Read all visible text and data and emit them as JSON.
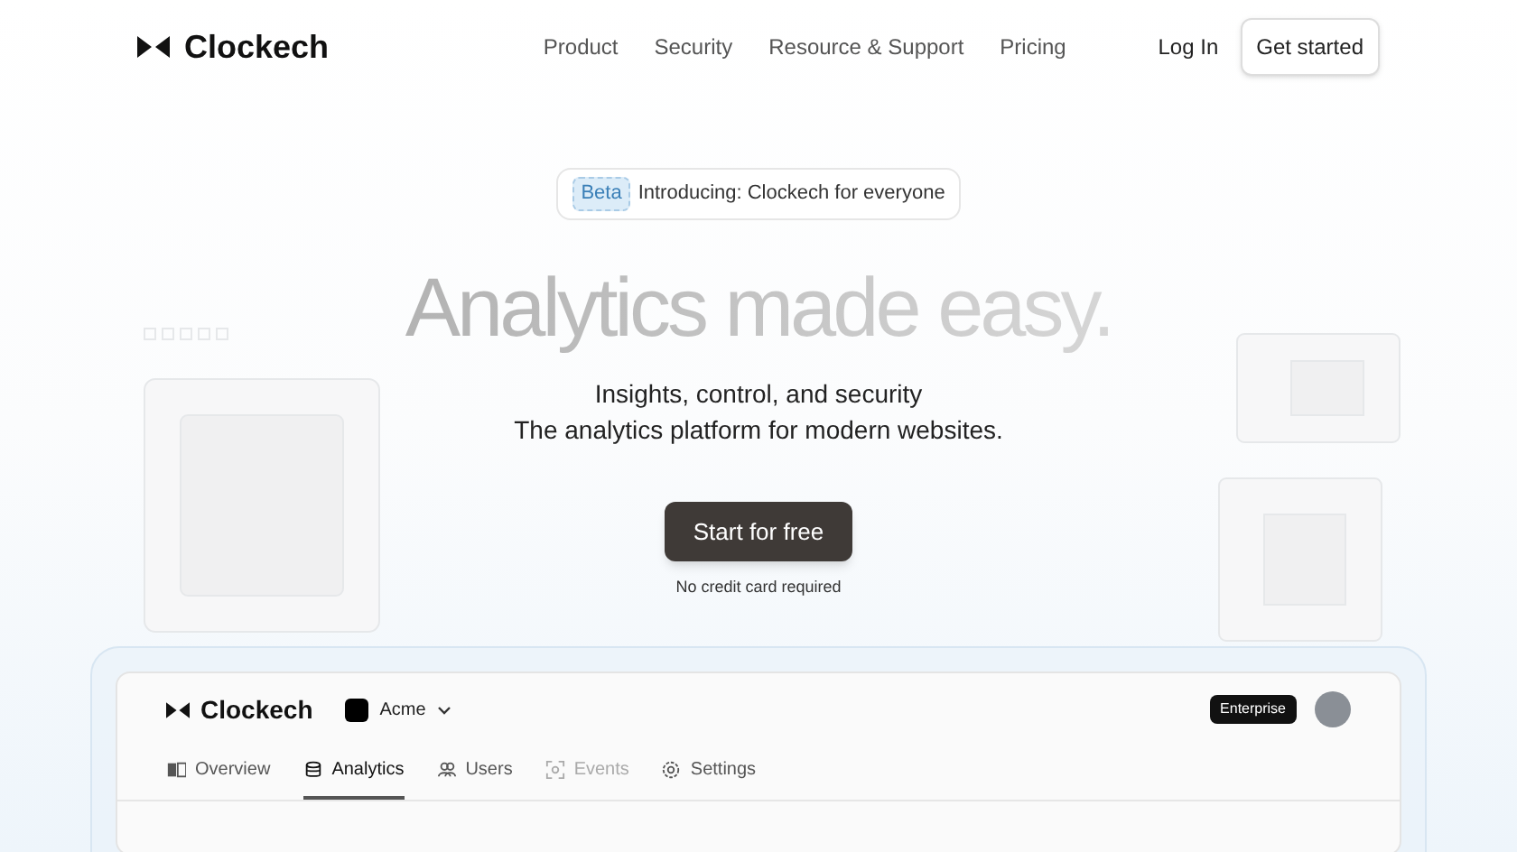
{
  "brand": "Clockech",
  "nav": [
    "Product",
    "Security",
    "Resource & Support",
    "Pricing"
  ],
  "login": "Log In",
  "cta": "Get started",
  "announcement": {
    "badge": "Beta",
    "text": "Introducing: Clockech for everyone"
  },
  "headline": "Analytics made easy.",
  "subtitle": [
    "Insights, control, and security",
    "The analytics platform for modern websites."
  ],
  "primary_button": "Start for free",
  "note": "No credit card required",
  "dashboard": {
    "brand": "Clockech",
    "workspace": "Acme",
    "plan": "Enterprise",
    "tabs": [
      {
        "label": "Overview",
        "selected": false,
        "disabled": false
      },
      {
        "label": "Analytics",
        "selected": true,
        "disabled": false
      },
      {
        "label": "Users",
        "selected": false,
        "disabled": false
      },
      {
        "label": "Events",
        "selected": false,
        "disabled": true
      },
      {
        "label": "Settings",
        "selected": false,
        "disabled": false
      }
    ]
  }
}
